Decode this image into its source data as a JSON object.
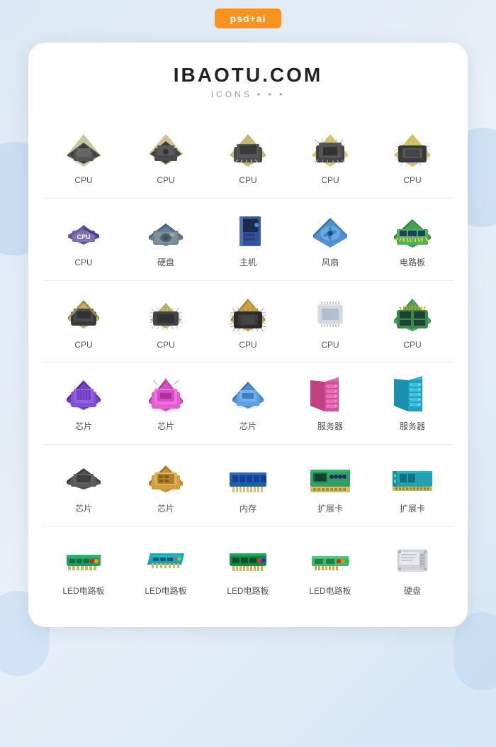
{
  "badge": "psd+ai",
  "title": "IBAOTU.COM",
  "subtitle": "ICONS",
  "rows": [
    {
      "items": [
        {
          "label": "CPU",
          "type": "cpu1"
        },
        {
          "label": "CPU",
          "type": "cpu2"
        },
        {
          "label": "CPU",
          "type": "cpu3"
        },
        {
          "label": "CPU",
          "type": "cpu4"
        },
        {
          "label": "CPU",
          "type": "cpu5"
        }
      ]
    },
    {
      "items": [
        {
          "label": "CPU",
          "type": "cpu6"
        },
        {
          "label": "硬盘",
          "type": "hdd1"
        },
        {
          "label": "主机",
          "type": "mainpc"
        },
        {
          "label": "风扇",
          "type": "fan"
        },
        {
          "label": "电路板",
          "type": "board1"
        }
      ]
    },
    {
      "items": [
        {
          "label": "CPU",
          "type": "cpu7"
        },
        {
          "label": "CPU",
          "type": "cpu8"
        },
        {
          "label": "CPU",
          "type": "cpu9"
        },
        {
          "label": "CPU",
          "type": "cpu10"
        },
        {
          "label": "CPU",
          "type": "cpu11"
        }
      ]
    },
    {
      "items": [
        {
          "label": "芯片",
          "type": "chip1"
        },
        {
          "label": "芯片",
          "type": "chip2"
        },
        {
          "label": "芯片",
          "type": "chip3"
        },
        {
          "label": "服务器",
          "type": "server1"
        },
        {
          "label": "服务器",
          "type": "server2"
        }
      ]
    },
    {
      "items": [
        {
          "label": "芯片",
          "type": "chip4"
        },
        {
          "label": "芯片",
          "type": "chip5"
        },
        {
          "label": "内存",
          "type": "ram"
        },
        {
          "label": "扩展卡",
          "type": "extcard1"
        },
        {
          "label": "扩展卡",
          "type": "extcard2"
        }
      ]
    },
    {
      "items": [
        {
          "label": "LED电路板",
          "type": "led1"
        },
        {
          "label": "LED电路板",
          "type": "led2"
        },
        {
          "label": "LED电路板",
          "type": "led3"
        },
        {
          "label": "LED电路板",
          "type": "led4"
        },
        {
          "label": "硬盘",
          "type": "hdd2"
        }
      ]
    }
  ],
  "colors": {
    "badge_bg": "#f7931e",
    "card_bg": "#ffffff",
    "page_bg": "#dce8f5",
    "label": "#555555"
  }
}
